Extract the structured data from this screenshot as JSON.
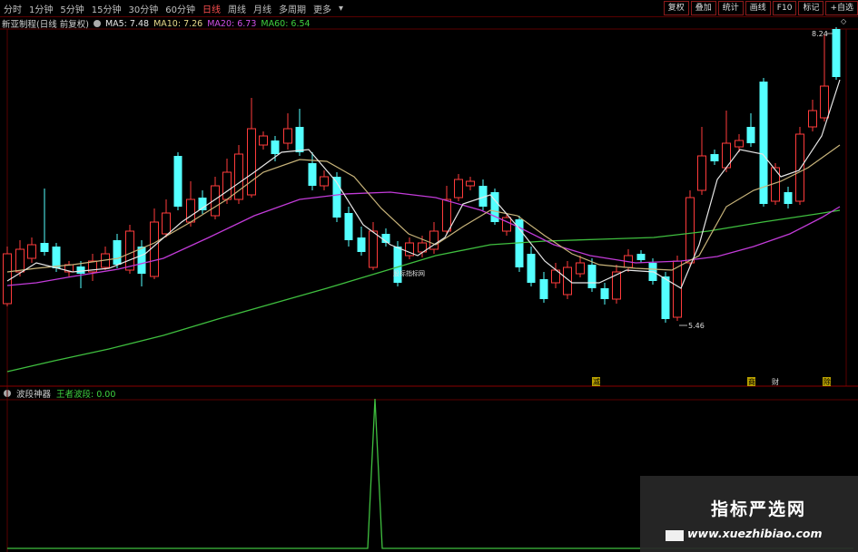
{
  "toolbar": {
    "periods": [
      "分时",
      "1分钟",
      "5分钟",
      "15分钟",
      "30分钟",
      "60分钟",
      "日线",
      "周线",
      "月线",
      "多周期",
      "更多"
    ],
    "buttons": [
      "复权",
      "叠加",
      "统计",
      "画线",
      "F10",
      "标记",
      "+自选"
    ]
  },
  "main_info": {
    "title": "新亚制程(日线 前复权)",
    "ma5": "MA5: 7.48",
    "ma10": "MA10: 7.26",
    "ma20": "MA20: 6.73",
    "ma60": "MA60: 6.54"
  },
  "indicator_info": {
    "name": "波段神器",
    "value": "王者波段: 0.00"
  },
  "labels": {
    "high": "8.24",
    "low": "5.46",
    "center_tag": "股标指标网",
    "events": [
      "减",
      "商",
      "财",
      "除"
    ]
  },
  "colors": {
    "up": "#ff3b3b",
    "down": "#54ffff",
    "ma5": "#e6e6e6",
    "ma10": "#c8b47a",
    "ma20": "#c23bd8",
    "ma60": "#3fbf3f",
    "indicator": "#3fbf3f"
  },
  "watermark": {
    "cn": "指标严选网",
    "url": "www.xuezhibiao.com"
  }
}
